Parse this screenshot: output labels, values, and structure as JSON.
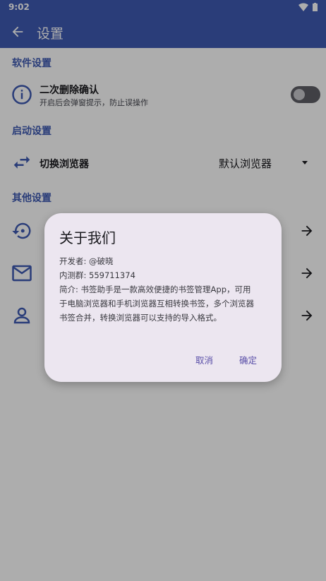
{
  "status": {
    "time": "9:02"
  },
  "app_bar": {
    "title": "设置"
  },
  "sections": {
    "software": "软件设置",
    "startup": "启动设置",
    "other": "其他设置"
  },
  "settings": {
    "double_confirm": {
      "title": "二次删除确认",
      "subtitle": "开启后会弹窗提示，防止误操作",
      "enabled": false
    },
    "browser": {
      "title": "切换浏览器",
      "value": "默认浏览器"
    },
    "other_items": [
      {
        "icon": "restore-icon"
      },
      {
        "icon": "mail-icon"
      },
      {
        "icon": "person-icon"
      }
    ]
  },
  "dialog": {
    "title": "关于我们",
    "developer": "开发者: @破晓",
    "test_group": "内测群: 559711374",
    "intro_1": "简介: 书签助手是一款高效便捷的书签管理App，可用",
    "intro_2": "于电脑浏览器和手机浏览器互相转换书签，多个浏览器",
    "intro_3": "书签合并，转换浏览器可以支持的导入格式。",
    "cancel": "取消",
    "confirm": "确定"
  },
  "colors": {
    "primary": "#3f5ab3",
    "dialog_bg": "#ece6f0",
    "accent": "#5a4fa8"
  }
}
